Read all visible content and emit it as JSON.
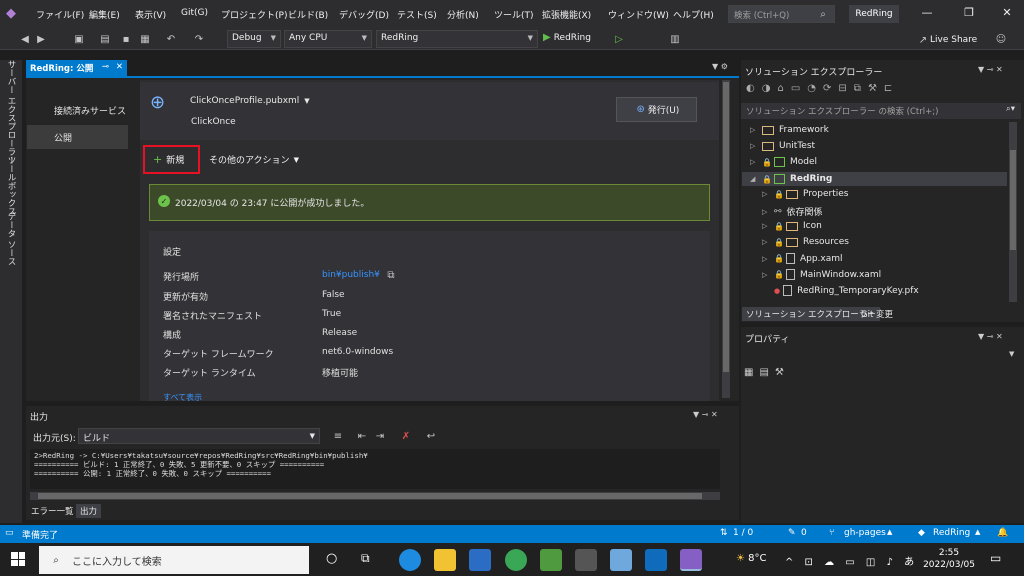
{
  "menubar": {
    "items": [
      "ファイル(F)",
      "編集(E)",
      "表示(V)",
      "Git(G)",
      "プロジェクト(P)",
      "ビルド(B)",
      "デバッグ(D)",
      "テスト(S)",
      "分析(N)",
      "ツール(T)",
      "拡張機能(X)",
      "ウィンドウ(W)",
      "ヘルプ(H)"
    ],
    "search_placeholder": "検索 (Ctrl+Q)",
    "project_name": "RedRing"
  },
  "toolbar": {
    "config": "Debug",
    "platform": "Any CPU",
    "startup_project": "RedRing",
    "run_label": "RedRing",
    "live_share": "Live Share"
  },
  "left_tabs": [
    "サーバー エクスプローラー",
    "ツールボックス",
    "データ ソース"
  ],
  "document": {
    "tab_title": "RedRing: 公開",
    "nav": [
      "接続済みサービス",
      "公開"
    ],
    "profile_name": "ClickOnceProfile.pubxml",
    "profile_type": "ClickOnce",
    "publish_button": "発行(U)",
    "new_button": "新規",
    "more_actions": "その他のアクション",
    "success_message": "2022/03/04 の 23:47 に公開が成功しました。",
    "settings_title": "設定",
    "settings": [
      {
        "label": "発行場所",
        "value": "bin¥publish¥"
      },
      {
        "label": "更新が有効",
        "value": "False"
      },
      {
        "label": "署名されたマニフェスト",
        "value": "True"
      },
      {
        "label": "構成",
        "value": "Release"
      },
      {
        "label": "ターゲット フレームワーク",
        "value": "net6.0-windows"
      },
      {
        "label": "ターゲット ランタイム",
        "value": "移植可能"
      }
    ],
    "show_all": "すべて表示"
  },
  "output": {
    "title": "出力",
    "source_label": "出力元(S):",
    "source_value": "ビルド",
    "text": "2>RedRing -> C:¥Users¥takatsu¥source¥repos¥RedRing¥src¥RedRing¥bin¥publish¥\n========== ビルド: 1 正常終了、0 失敗、5 更新不要、0 スキップ ==========\n========== 公開: 1 正常終了、0 失敗、0 スキップ ==========",
    "tabs": [
      "エラー一覧",
      "出力"
    ]
  },
  "solution_explorer": {
    "title": "ソリューション エクスプローラー",
    "search_placeholder": "ソリューション エクスプローラー の検索 (Ctrl+;)",
    "items": [
      {
        "label": "Framework",
        "kind": "folder"
      },
      {
        "label": "UnitTest",
        "kind": "folder"
      },
      {
        "label": "Model",
        "kind": "project"
      },
      {
        "label": "RedRing",
        "kind": "project"
      },
      {
        "label": "Properties",
        "kind": "folder"
      },
      {
        "label": "依存関係",
        "kind": "deps"
      },
      {
        "label": "Icon",
        "kind": "folder"
      },
      {
        "label": "Resources",
        "kind": "folder"
      },
      {
        "label": "App.xaml",
        "kind": "file"
      },
      {
        "label": "MainWindow.xaml",
        "kind": "file"
      },
      {
        "label": "RedRing_TemporaryKey.pfx",
        "kind": "file"
      }
    ],
    "tabs": [
      "ソリューション エクスプローラー",
      "Git 変更"
    ]
  },
  "properties": {
    "title": "プロパティ"
  },
  "statusbar": {
    "ready": "準備完了",
    "line_info": "1 / 0",
    "edits": "0",
    "branch": "gh-pages",
    "repo": "RedRing"
  },
  "taskbar": {
    "search_placeholder": "ここに入力して検索",
    "temperature": "8°C",
    "time": "2:55",
    "date": "2022/03/05"
  },
  "colors": {
    "accent": "#007acc",
    "success_bg": "#3d4a2a",
    "highlight_border": "#e81123"
  }
}
